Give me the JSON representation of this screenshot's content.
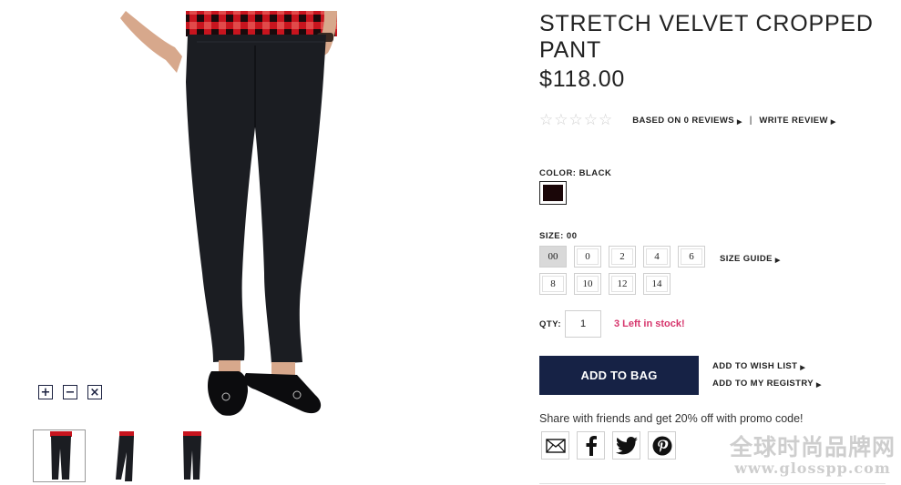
{
  "product": {
    "title": "STRETCH VELVET CROPPED PANT",
    "price": "$118.00"
  },
  "reviews": {
    "stars_filled": 0,
    "stars_total": 5,
    "reviews_link": "BASED ON 0 REVIEWS",
    "separator": "|",
    "write_review": "WRITE REVIEW"
  },
  "color": {
    "label": "COLOR: BLACK",
    "swatch_hex": "#1a0608"
  },
  "size": {
    "label": "SIZE: 00",
    "options": [
      "00",
      "0",
      "2",
      "4",
      "6",
      "8",
      "10",
      "12",
      "14"
    ],
    "selected": "00",
    "guide_link": "SIZE GUIDE"
  },
  "quantity": {
    "label": "QTY:",
    "value": "1",
    "stock_message": "3 Left in stock!"
  },
  "actions": {
    "add_to_bag": "ADD TO BAG",
    "wish_list": "ADD TO WISH LIST",
    "registry": "ADD TO MY REGISTRY"
  },
  "share": {
    "text": "Share with friends and get 20% off with promo code!",
    "icons": [
      "email-icon",
      "facebook-icon",
      "twitter-icon",
      "pinterest-icon"
    ]
  },
  "zoom": {
    "icons": [
      "zoom-in-icon",
      "zoom-out-icon",
      "close-icon"
    ]
  },
  "watermark": {
    "line1": "全球时尚品牌网",
    "line2": "www.glosspp.com"
  },
  "colors": {
    "brand_navy": "#162245",
    "stock_pink": "#d6356c",
    "border_gray": "#cfcfcf"
  }
}
